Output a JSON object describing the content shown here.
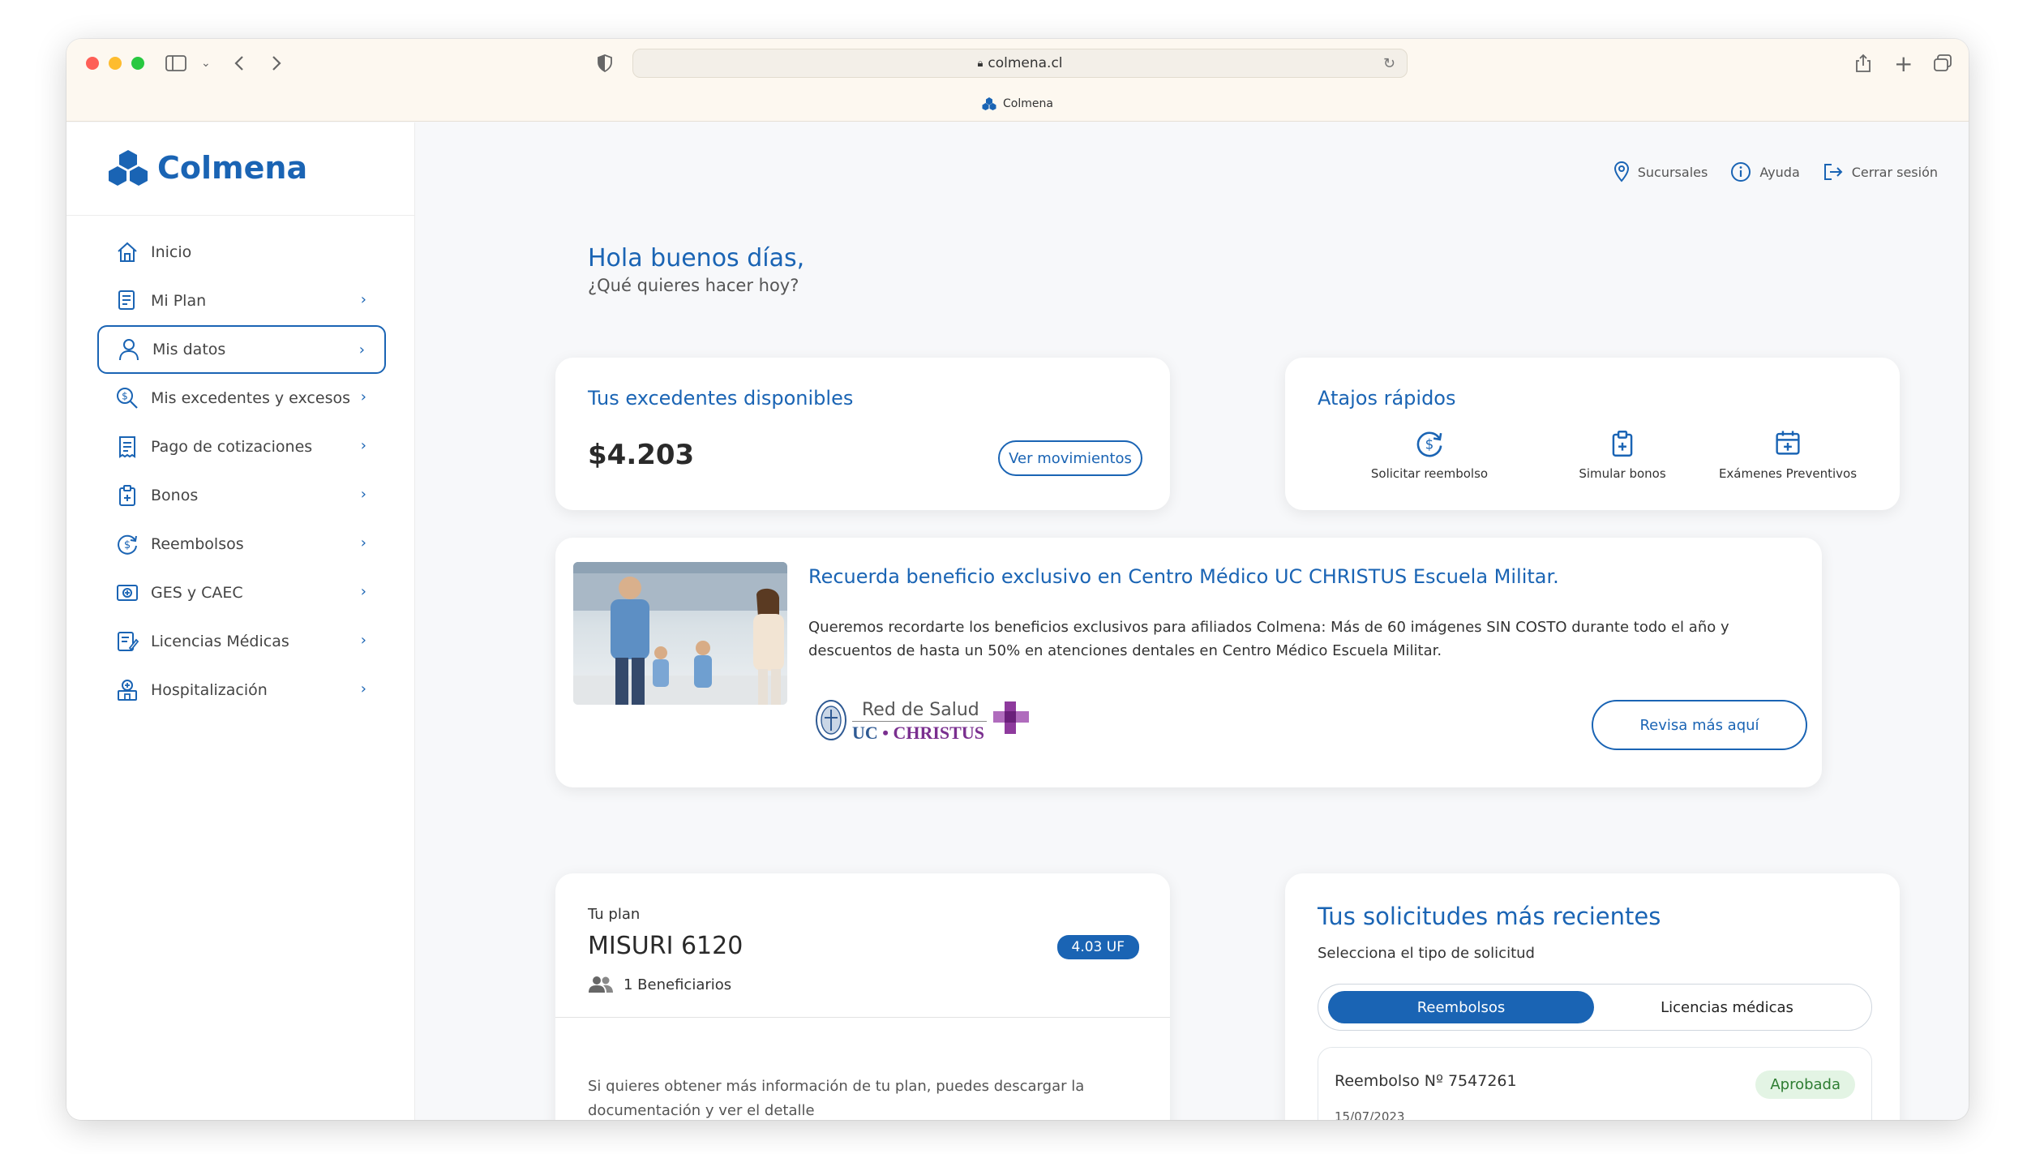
{
  "browser": {
    "url": "colmena.cl",
    "tab_title": "Colmena",
    "colors": {
      "close": "#fe5f57",
      "minimize": "#febc2e",
      "maximize": "#28c840"
    }
  },
  "brand": {
    "name": "Colmena",
    "color": "#1a64b4"
  },
  "sidebar": {
    "items": [
      {
        "label": "Inicio",
        "icon": "home-icon",
        "chevron": false
      },
      {
        "label": "Mi Plan",
        "icon": "document-icon",
        "chevron": true
      },
      {
        "label": "Mis datos",
        "icon": "user-icon",
        "chevron": true,
        "active": true
      },
      {
        "label": "Mis excedentes y excesos",
        "icon": "money-search-icon",
        "chevron": true
      },
      {
        "label": "Pago de cotizaciones",
        "icon": "receipt-icon",
        "chevron": true
      },
      {
        "label": "Bonos",
        "icon": "voucher-icon",
        "chevron": true
      },
      {
        "label": "Reembolsos",
        "icon": "refund-icon",
        "chevron": true
      },
      {
        "label": "GES y CAEC",
        "icon": "medical-card-icon",
        "chevron": true
      },
      {
        "label": "Licencias Médicas",
        "icon": "medical-license-icon",
        "chevron": true
      },
      {
        "label": "Hospitalización",
        "icon": "hospital-icon",
        "chevron": true
      }
    ]
  },
  "header": {
    "links": [
      {
        "label": "Sucursales",
        "icon": "location-pin-icon"
      },
      {
        "label": "Ayuda",
        "icon": "info-icon"
      },
      {
        "label": "Cerrar sesión",
        "icon": "logout-icon"
      }
    ]
  },
  "greeting": {
    "title": "Hola buenos días,",
    "subtitle": "¿Qué quieres hacer hoy?"
  },
  "excedentes": {
    "title": "Tus excedentes disponibles",
    "amount": "$4.203",
    "button": "Ver movimientos"
  },
  "atajos": {
    "title": "Atajos rápidos",
    "items": [
      {
        "label": "Solicitar reembolso",
        "icon": "refund-icon"
      },
      {
        "label": "Simular bonos",
        "icon": "voucher-icon"
      },
      {
        "label": "Exámenes Preventivos",
        "icon": "calendar-medical-icon"
      }
    ]
  },
  "promo": {
    "title": "Recuerda beneficio exclusivo en Centro Médico UC CHRISTUS Escuela Militar.",
    "body": "Queremos recordarte los beneficios exclusivos para afiliados Colmena: Más de 60 imágenes SIN COSTO durante todo el año y descuentos de hasta un 50% en atenciones dentales en Centro Médico Escuela Militar.",
    "logo_line1": "Red de Salud",
    "logo_uc": "UC",
    "logo_dot": "•",
    "logo_christus": "CHRISTUS",
    "button": "Revisa más aquí"
  },
  "plan": {
    "label": "Tu plan",
    "name": "MISURI 6120",
    "badge": "4.03 UF",
    "beneficiaries": "1 Beneficiarios",
    "info": "Si quieres obtener más información de tu plan, puedes descargar la documentación y ver el detalle"
  },
  "solicitudes": {
    "title": "Tus solicitudes más recientes",
    "subtitle": "Selecciona el tipo de solicitud",
    "tabs": [
      {
        "label": "Reembolsos",
        "active": true
      },
      {
        "label": "Licencias médicas",
        "active": false
      }
    ],
    "item": {
      "title": "Reembolso Nº 7547261",
      "date": "15/07/2023",
      "status": "Aprobada"
    }
  }
}
